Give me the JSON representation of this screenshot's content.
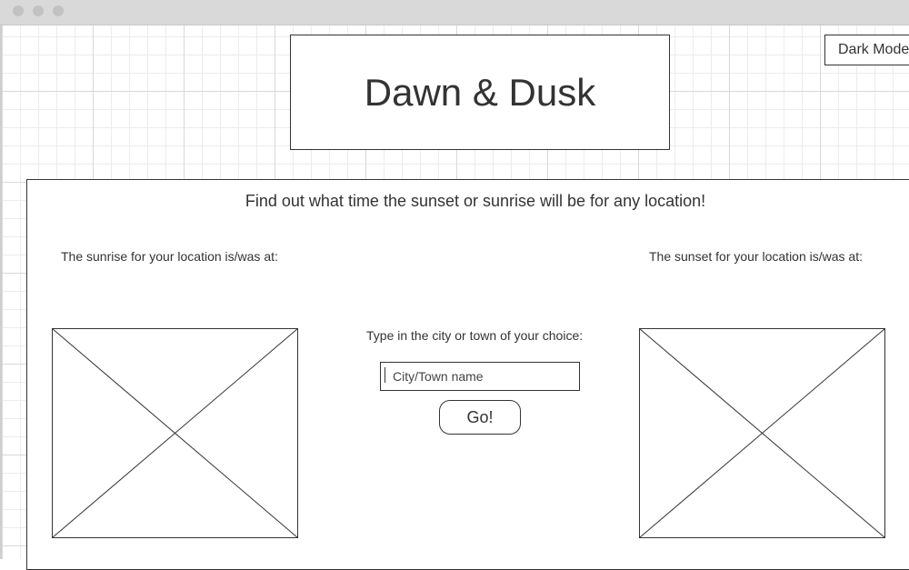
{
  "window": {
    "controls": [
      "close-dot",
      "minimize-dot",
      "maximize-dot"
    ]
  },
  "header": {
    "title": "Dawn & Dusk",
    "dark_mode_label": "Dark Mode"
  },
  "main": {
    "tagline": "Find out what time the sunset or sunrise will be for any location!",
    "sunrise_label": "The sunrise for your location is/was at:",
    "sunset_label": "The sunset for your location is/was at:",
    "search_prompt": "Type in the city or town of your choice:",
    "search": {
      "placeholder": "City/Town name",
      "value": ""
    },
    "go_label": "Go!"
  },
  "icons": {
    "sunrise_image": "image-placeholder-icon",
    "sunset_image": "image-placeholder-icon"
  }
}
